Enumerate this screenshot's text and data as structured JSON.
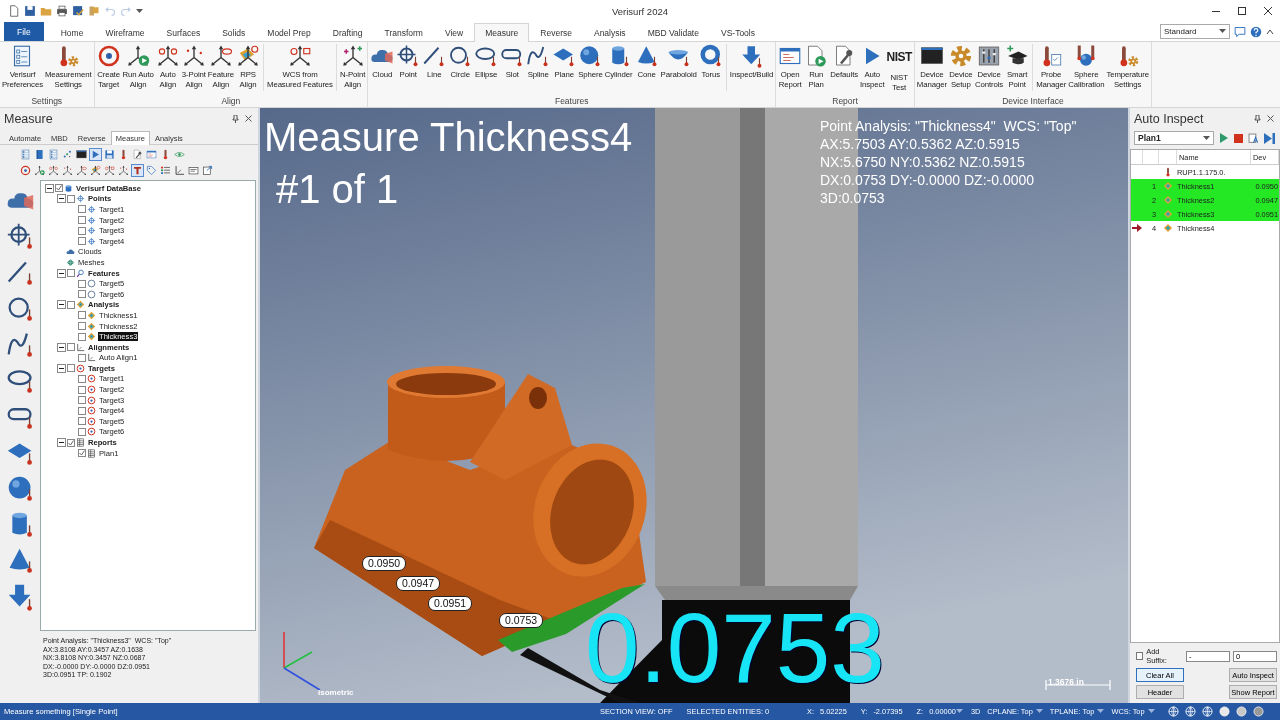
{
  "window": {
    "title": "Verisurf 2024"
  },
  "ribbon": {
    "tabs": [
      {
        "label": "File",
        "kind": "file",
        "selected": false
      },
      {
        "label": "Home",
        "kind": "tab",
        "selected": false
      },
      {
        "label": "Wireframe",
        "kind": "tab",
        "selected": false
      },
      {
        "label": "Surfaces",
        "kind": "tab",
        "selected": false
      },
      {
        "label": "Solids",
        "kind": "tab",
        "selected": false
      },
      {
        "label": "Model Prep",
        "kind": "tab",
        "selected": false
      },
      {
        "label": "Drafting",
        "kind": "tab",
        "selected": false
      },
      {
        "label": "Transform",
        "kind": "tab",
        "selected": false
      },
      {
        "label": "View",
        "kind": "tab",
        "selected": false
      },
      {
        "label": "Measure",
        "kind": "tab",
        "selected": true
      },
      {
        "label": "Reverse",
        "kind": "tab",
        "selected": false
      },
      {
        "label": "Analysis",
        "kind": "tab",
        "selected": false
      },
      {
        "label": "MBD Validate",
        "kind": "tab",
        "selected": false
      },
      {
        "label": "VS-Tools",
        "kind": "tab",
        "selected": false
      }
    ],
    "workspace": "Standard",
    "groups": [
      {
        "label": "Settings",
        "buttons": [
          {
            "label": "Verisurf\nPreferences"
          },
          {
            "label": "Measurement\nSettings"
          }
        ]
      },
      {
        "label": "Align",
        "buttons": [
          {
            "label": "Create\nTarget"
          },
          {
            "label": "Run Auto\nAlign"
          },
          {
            "label": "Auto\nAlign"
          },
          {
            "label": "3-Point\nAlign"
          },
          {
            "label": "Feature\nAlign"
          },
          {
            "label": "RPS\nAlign"
          },
          {
            "label": "WCS from\nMeasured Features",
            "separated": true
          },
          {
            "label": "N-Point\nAlign",
            "separated": true
          }
        ]
      },
      {
        "label": "Features",
        "buttons": [
          {
            "label": "Cloud"
          },
          {
            "label": "Point"
          },
          {
            "label": "Line"
          },
          {
            "label": "Circle"
          },
          {
            "label": "Ellipse"
          },
          {
            "label": "Slot"
          },
          {
            "label": "Spline"
          },
          {
            "label": "Plane"
          },
          {
            "label": "Sphere"
          },
          {
            "label": "Cylinder"
          },
          {
            "label": "Cone"
          },
          {
            "label": "Paraboloid"
          },
          {
            "label": "Torus"
          },
          {
            "label": "Inspect/Build",
            "separated": true
          }
        ]
      },
      {
        "label": "Report",
        "buttons": [
          {
            "label": "Open\nReport"
          },
          {
            "label": "Run\nPlan"
          },
          {
            "label": "Defaults"
          },
          {
            "label": "Auto\nInspect"
          },
          {
            "label": "NIST\nTest",
            "logo": "NIST"
          }
        ]
      },
      {
        "label": "Device Interface",
        "buttons": [
          {
            "label": "Device\nManager"
          },
          {
            "label": "Device\nSetup"
          },
          {
            "label": "Device\nControls"
          },
          {
            "label": "Smart\nPoint"
          },
          {
            "label": "Probe\nManager",
            "separated": true
          },
          {
            "label": "Sphere\nCalibration"
          },
          {
            "label": "Temperature\nSettings"
          }
        ]
      }
    ]
  },
  "measure_panel": {
    "title": "Measure",
    "tabs": [
      {
        "label": "Automate",
        "selected": false
      },
      {
        "label": "MBD",
        "selected": false
      },
      {
        "label": "Reverse",
        "selected": false
      },
      {
        "label": "Measure",
        "selected": true
      },
      {
        "label": "Analysis",
        "selected": false
      }
    ],
    "tree": [
      {
        "label": "Verisurf DataBase",
        "kind": "database",
        "checked": true,
        "expanded": true,
        "selected": false,
        "children": [
          {
            "label": "Points",
            "kind": "point",
            "checked": false,
            "expanded": true,
            "selected": false,
            "children": [
              {
                "label": "Target1",
                "kind": "point",
                "checked": false,
                "selected": false
              },
              {
                "label": "Target2",
                "kind": "point",
                "checked": false,
                "selected": false
              },
              {
                "label": "Target3",
                "kind": "point",
                "checked": false,
                "selected": false
              },
              {
                "label": "Target4",
                "kind": "point",
                "checked": false,
                "selected": false
              }
            ]
          },
          {
            "label": "Clouds",
            "kind": "cloud",
            "selected": false
          },
          {
            "label": "Meshes",
            "kind": "mesh",
            "selected": false
          },
          {
            "label": "Features",
            "kind": "feature",
            "checked": false,
            "expanded": true,
            "selected": false,
            "children": [
              {
                "label": "Target5",
                "kind": "circle",
                "checked": false,
                "selected": false
              },
              {
                "label": "Target6",
                "kind": "circle",
                "checked": false,
                "selected": false
              }
            ]
          },
          {
            "label": "Analysis",
            "kind": "analysis",
            "checked": false,
            "expanded": true,
            "selected": false,
            "children": [
              {
                "label": "Thickness1",
                "kind": "analysis",
                "checked": false,
                "selected": false
              },
              {
                "label": "Thickness2",
                "kind": "analysis",
                "checked": false,
                "selected": false
              },
              {
                "label": "Thickness3",
                "kind": "analysis",
                "checked": false,
                "selected": true
              }
            ]
          },
          {
            "label": "Alignments",
            "kind": "alignment",
            "checked": false,
            "expanded": true,
            "selected": false,
            "children": [
              {
                "label": "Auto Align1",
                "kind": "alignment",
                "checked": false,
                "selected": false
              }
            ]
          },
          {
            "label": "Targets",
            "kind": "target",
            "checked": false,
            "expanded": true,
            "selected": false,
            "children": [
              {
                "label": "Target1",
                "kind": "target",
                "checked": false,
                "selected": false
              },
              {
                "label": "Target2",
                "kind": "target",
                "checked": false,
                "selected": false
              },
              {
                "label": "Target3",
                "kind": "target",
                "checked": false,
                "selected": false
              },
              {
                "label": "Target4",
                "kind": "target",
                "checked": false,
                "selected": false
              },
              {
                "label": "Target5",
                "kind": "target",
                "checked": false,
                "selected": false
              },
              {
                "label": "Target6",
                "kind": "target",
                "checked": false,
                "selected": false
              }
            ]
          },
          {
            "label": "Reports",
            "kind": "report",
            "checked": true,
            "expanded": true,
            "selected": false,
            "children": [
              {
                "label": "Plan1",
                "kind": "report",
                "checked": true,
                "selected": false
              }
            ]
          }
        ]
      }
    ],
    "info_lines": [
      "Point Analysis: \"Thickness3\"  WCS: \"Top\"",
      "AX:3.8108 AY:0.3457 AZ:0.1638",
      "NX:3.8108 NY:0.3457 NZ:0.0687",
      "DX:-0.0000 DY:-0.0000 DZ:0.0951",
      "3D:0.0951 TP: 0.1902"
    ]
  },
  "viewport": {
    "title": "Measure Thickness4",
    "counter": "#1 of 1",
    "analysis_lines": [
      "Point Analysis: \"Thickness4\"  WCS: \"Top\"",
      "AX:5.7503 AY:0.5362 AZ:0.5915",
      "NX:5.6750 NY:0.5362 NZ:0.5915",
      "DX:0.0753 DY:-0.0000 DZ:-0.0000",
      "3D:0.0753"
    ],
    "labels": [
      "0.0950",
      "0.0947",
      "0.0951",
      "0.0753"
    ],
    "readout": "0.0753",
    "view_name": "Isometric",
    "scale": "1.3676 in"
  },
  "auto_inspect": {
    "title": "Auto Inspect",
    "plan": "Plan1",
    "columns": [
      "Name",
      "Dev"
    ],
    "rows": [
      {
        "name": "RUP1.1.175.0.",
        "kind": "probe",
        "completed": false,
        "current": false
      },
      {
        "index": "1",
        "name": "Thickness1",
        "dev": "0.0950",
        "kind": "analysis",
        "completed": true,
        "current": false
      },
      {
        "index": "2",
        "name": "Thickness2",
        "dev": "0.0947",
        "kind": "analysis",
        "completed": true,
        "current": false
      },
      {
        "index": "3",
        "name": "Thickness3",
        "dev": "0.0951",
        "kind": "analysis",
        "completed": true,
        "current": false
      },
      {
        "index": "4",
        "name": "Thickness4",
        "kind": "analysis",
        "completed": false,
        "current": true
      }
    ],
    "suffix": {
      "label": "Add Suffix:",
      "checked": false,
      "values": [
        "-",
        "0"
      ]
    },
    "buttons": [
      {
        "label": "Clear All",
        "focused": true
      },
      {
        "label": "Auto Inspect",
        "focused": false
      },
      {
        "label": "Header",
        "focused": false
      },
      {
        "label": "Show Report",
        "focused": false
      }
    ]
  },
  "status_bar": {
    "message": "Measure something [Single Point]",
    "section_view": "SECTION VIEW: OFF",
    "selected_entities": "SELECTED ENTITIES: 0",
    "coords": [
      {
        "label": "X:",
        "value": "5.02225"
      },
      {
        "label": "Y:",
        "value": "-2.07395"
      },
      {
        "label": "Z:",
        "value": "0.00000"
      }
    ],
    "mode": "3D",
    "planes": [
      "CPLANE: Top",
      "TPLANE: Top",
      "WCS: Top"
    ]
  }
}
